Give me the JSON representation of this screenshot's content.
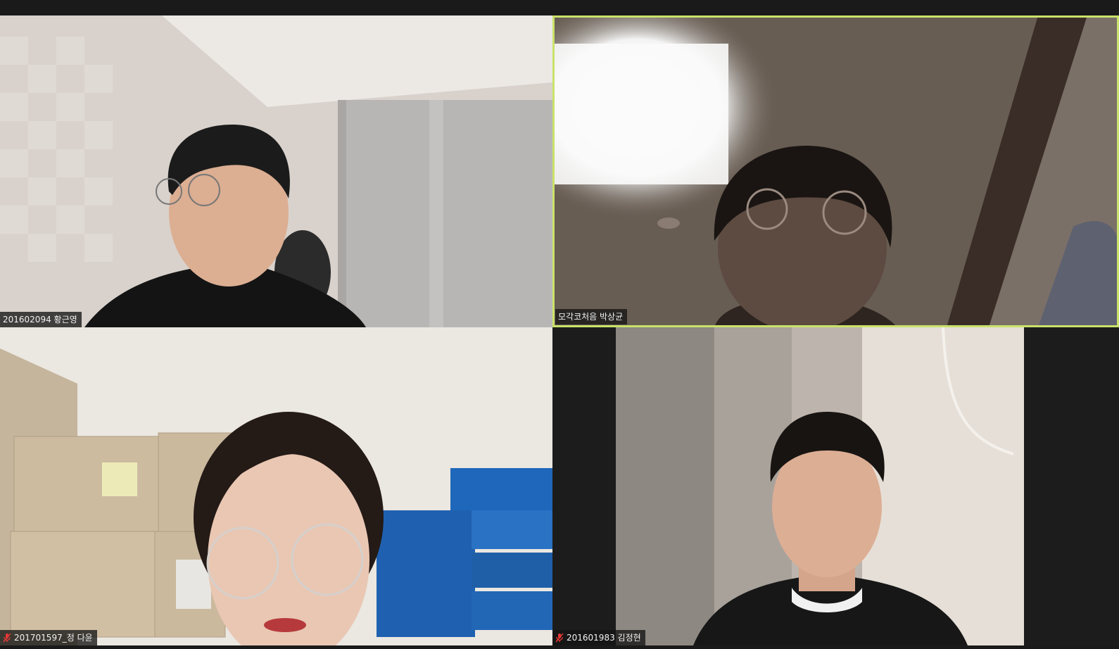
{
  "app": "Zoom Gallery View",
  "active_speaker_color": "#c9e26a",
  "participants": [
    {
      "name": "201602094 황근영",
      "muted": false
    },
    {
      "name": "모각코처음 박상균",
      "muted": false
    },
    {
      "name": "201701597_정 다윤",
      "muted": true
    },
    {
      "name": "201601983 김정현",
      "muted": true
    }
  ]
}
